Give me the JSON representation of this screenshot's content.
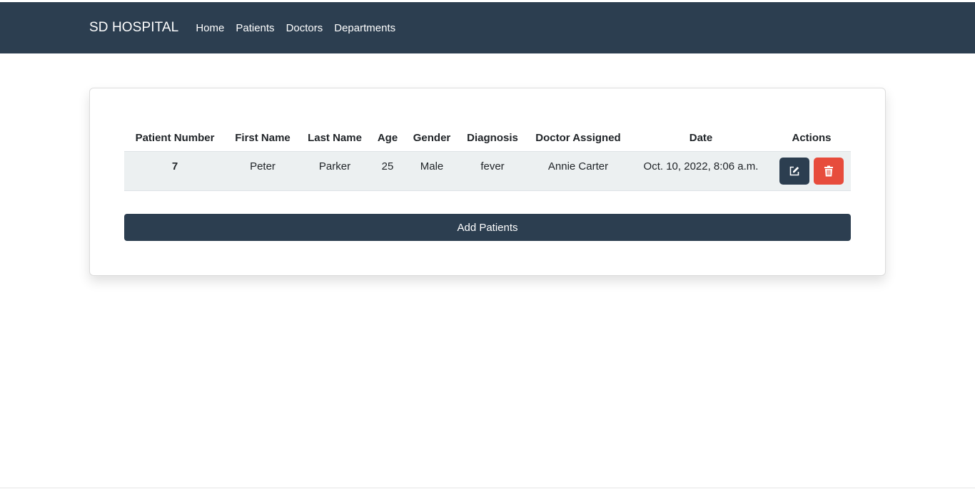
{
  "navbar": {
    "brand": "SD HOSPITAL",
    "links": [
      "Home",
      "Patients",
      "Doctors",
      "Departments"
    ]
  },
  "table": {
    "headers": [
      "Patient Number",
      "First Name",
      "Last Name",
      "Age",
      "Gender",
      "Diagnosis",
      "Doctor Assigned",
      "Date",
      "Actions"
    ],
    "rows": [
      {
        "patient_number": "7",
        "first_name": "Peter",
        "last_name": "Parker",
        "age": "25",
        "gender": "Male",
        "diagnosis": "fever",
        "doctor": "Annie Carter",
        "date": "Oct. 10, 2022, 8:06 a.m.",
        "actions": [
          {
            "icon": "edit-icon",
            "color": "#2c3e50"
          },
          {
            "icon": "trash-icon",
            "color": "#e74c3c"
          }
        ]
      }
    ]
  },
  "add_button": "Add Patients",
  "colors": {
    "navbar": "#2c3e50",
    "row_background": "#ecf0f1",
    "edit": "#2c3e50",
    "delete": "#e74c3c"
  }
}
